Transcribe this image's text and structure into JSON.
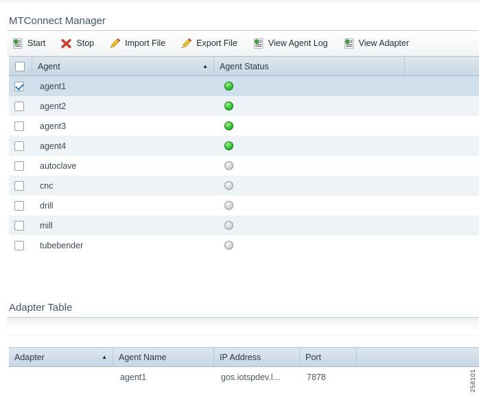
{
  "figure_id": "258101",
  "manager": {
    "title": "MTConnect Manager",
    "toolbar": {
      "start": "Start",
      "stop": "Stop",
      "import_file": "Import File",
      "export_file": "Export File",
      "view_agent_log": "View Agent Log",
      "view_adapter": "View Adapter"
    },
    "table": {
      "columns": {
        "agent": "Agent",
        "status": "Agent Status"
      },
      "sort_icon": "▲",
      "rows": [
        {
          "name": "agent1",
          "status": "green",
          "checked": true,
          "selected": true
        },
        {
          "name": "agent2",
          "status": "green",
          "checked": false,
          "selected": false
        },
        {
          "name": "agent3",
          "status": "green",
          "checked": false,
          "selected": false
        },
        {
          "name": "agent4",
          "status": "green",
          "checked": false,
          "selected": false
        },
        {
          "name": "autoclave",
          "status": "gray",
          "checked": false,
          "selected": false
        },
        {
          "name": "cnc",
          "status": "gray",
          "checked": false,
          "selected": false
        },
        {
          "name": "drill",
          "status": "gray",
          "checked": false,
          "selected": false
        },
        {
          "name": "mill",
          "status": "gray",
          "checked": false,
          "selected": false
        },
        {
          "name": "tubebender",
          "status": "gray",
          "checked": false,
          "selected": false
        }
      ]
    }
  },
  "adapter": {
    "title": "Adapter Table",
    "columns": {
      "adapter": "Adapter",
      "agent_name": "Agent Name",
      "ip": "IP Address",
      "port": "Port"
    },
    "sort_icon": "▲",
    "rows": [
      {
        "adapter": "",
        "agent_name": "agent1",
        "ip": "gos.iotspdev.l...",
        "port": "7878"
      }
    ]
  },
  "colors": {
    "title_text": "#44546a",
    "header_bg": "#ccdbe8",
    "selected_row": "#cfdfec",
    "stripe_row": "#eef3f8",
    "status_green": "#35c435",
    "status_gray": "#d7d7d7",
    "check_blue": "#1a82cf",
    "stop_red": "#c8402e",
    "pencil_yellow": "#f2c12e"
  }
}
